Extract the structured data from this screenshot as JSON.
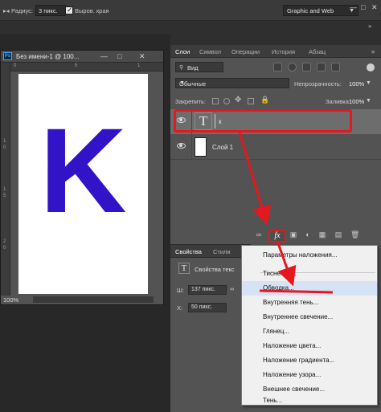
{
  "options_bar": {
    "radius_label": "Радиус:",
    "radius_value": "3 пикс.",
    "smooth_label": "Выров. края",
    "workspace": "Graphic and Web"
  },
  "document": {
    "title": "Без имени-1 @ 100...",
    "badge": "Ps",
    "zoom": "100%",
    "letter": "K",
    "letter_color": "#3213c8",
    "ruler_top": [
      "0",
      "5",
      "1"
    ],
    "ruler_left": [
      "1",
      "0",
      "1",
      "5",
      "2",
      "0"
    ]
  },
  "layers_panel": {
    "tabs": [
      "Слои",
      "Символ",
      "Операции",
      "История",
      "Абзац"
    ],
    "filter_label": "Вид",
    "blend_mode": "Обычные",
    "opacity_label": "Непрозрачность:",
    "opacity_value": "100%",
    "lock_label": "Закрепить:",
    "fill_label": "Заливка:",
    "fill_value": "100%",
    "layers": [
      {
        "name": "к",
        "type": "text",
        "thumb": "T"
      },
      {
        "name": "Слой 1",
        "type": "pixel"
      }
    ],
    "fx_label": "fx"
  },
  "properties_panel": {
    "tabs": [
      "Свойства",
      "Стили"
    ],
    "type_label": "Свойства текс",
    "thumb": "T",
    "w_label": "Ш:",
    "w_value": "137 пикс.",
    "x_label": "X:",
    "x_value": "50 пикс."
  },
  "fx_menu": {
    "items": [
      "Параметры наложения...",
      "Тиснение...",
      "Обводка...",
      "Внутренняя тень...",
      "Внутреннее свечение...",
      "Глянец...",
      "Наложение цвета...",
      "Наложение градиента...",
      "Наложение узора...",
      "Внешнее свечение...",
      "Тень..."
    ],
    "highlighted_index": 2
  },
  "annotation": {
    "color": "#e5171f"
  }
}
